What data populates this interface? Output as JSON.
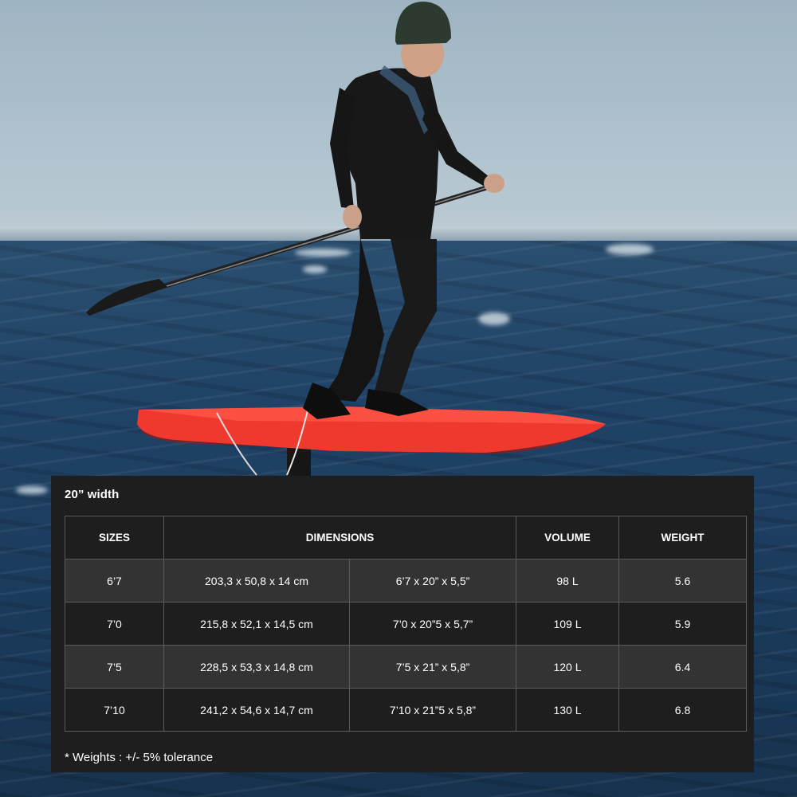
{
  "photo": {
    "subject": "surfer-on-red-foil-board"
  },
  "panel": {
    "title": "20” width",
    "columns": {
      "sizes": "SIZES",
      "dimensions": "DIMENSIONS",
      "volume": "VOLUME",
      "weight": "WEIGHT"
    },
    "rows": [
      {
        "size": "6’7",
        "metric": "203,3 x 50,8 x 14 cm",
        "imperial": "6’7 x 20” x 5,5”",
        "volume": "98 L",
        "weight": "5.6"
      },
      {
        "size": "7’0",
        "metric": "215,8 x 52,1 x 14,5 cm",
        "imperial": "7’0 x 20”5 x 5,7”",
        "volume": "109 L",
        "weight": "5.9"
      },
      {
        "size": "7’5",
        "metric": "228,5 x 53,3 x 14,8 cm",
        "imperial": "7’5 x 21” x 5,8”",
        "volume": "120 L",
        "weight": "6.4"
      },
      {
        "size": "7’10",
        "metric": "241,2 x 54,6 x 14,7 cm",
        "imperial": "7’10 x 21”5 x 5,8”",
        "volume": "130 L",
        "weight": "6.8"
      }
    ],
    "footnote": "* Weights : +/- 5% tolerance"
  },
  "colors": {
    "panel_bg": "#1e1e1e",
    "row_alt_bg": "#333333",
    "border": "#5a5a5a",
    "board_red": "#f0392e",
    "sea_blue": "#1f4266",
    "sky": "#aec1cd"
  }
}
